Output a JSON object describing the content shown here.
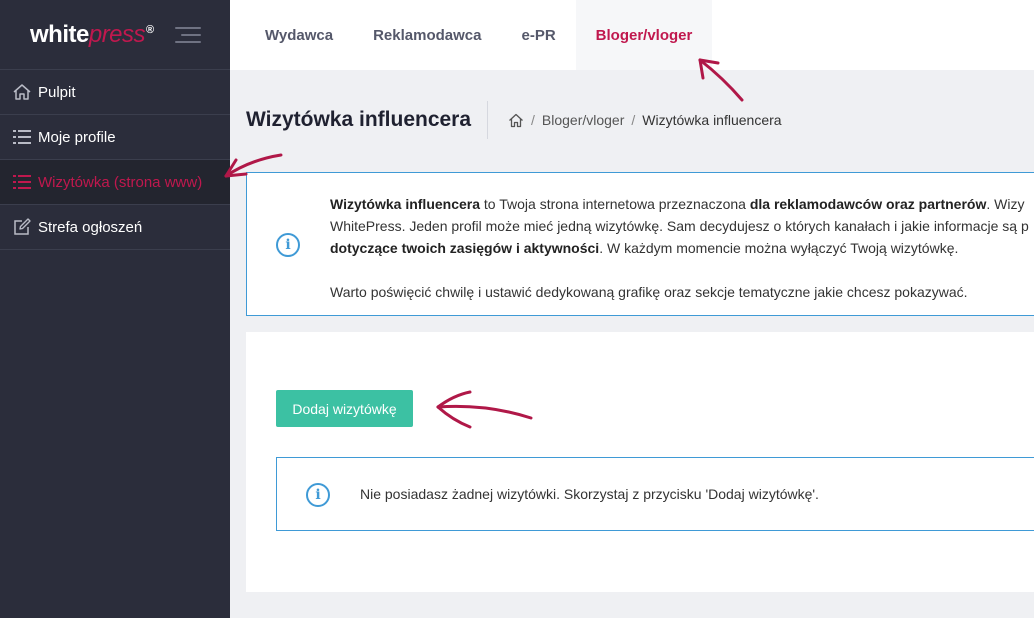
{
  "brand": {
    "logo_white": "white",
    "logo_press": "press",
    "logo_reg": "®"
  },
  "sidebar": {
    "items": [
      {
        "label": "Pulpit",
        "icon": "home-icon",
        "active": false
      },
      {
        "label": "Moje profile",
        "icon": "list-icon",
        "active": false
      },
      {
        "label": "Wizytówka (strona www)",
        "icon": "list-icon",
        "active": true
      },
      {
        "label": "Strefa ogłoszeń",
        "icon": "edit-icon",
        "active": false
      }
    ]
  },
  "topnav": {
    "tabs": [
      {
        "label": "Wydawca"
      },
      {
        "label": "Reklamodawca"
      },
      {
        "label": "e-PR"
      },
      {
        "label": "Bloger/vloger",
        "active": true
      }
    ]
  },
  "page": {
    "title": "Wizytówka influencera",
    "breadcrumb": [
      "Bloger/vloger",
      "Wizytówka influencera"
    ]
  },
  "info": {
    "line1_strong1": "Wizytówka influencera",
    "line1_text1": " to Twoja strona internetowa przeznaczona ",
    "line1_strong2": "dla reklamodawców oraz partnerów",
    "line1_text2": ". Wizy",
    "line2": "WhitePress. Jeden profil może mieć jedną wizytówkę. Sam decydujesz o których kanałach i jakie informacje są p",
    "line3_strong": "dotyczące twoich zasięgów i aktywności",
    "line3_text": ". W każdym momencie można wyłączyć Twoją wizytówkę.",
    "line4": "Warto poświęcić chwilę i ustawić dedykowaną grafikę oraz sekcje tematyczne jakie chcesz pokazywać."
  },
  "card": {
    "add_button": "Dodaj wizytówkę",
    "notice": "Nie posiadasz żadnej wizytówki. Skorzystaj z przycisku 'Dodaj wizytówkę'."
  },
  "colors": {
    "accent": "#c0184e",
    "teal": "#3cc1a3",
    "info_blue": "#3f9ad6",
    "sidebar_bg": "#2b2d3b"
  }
}
